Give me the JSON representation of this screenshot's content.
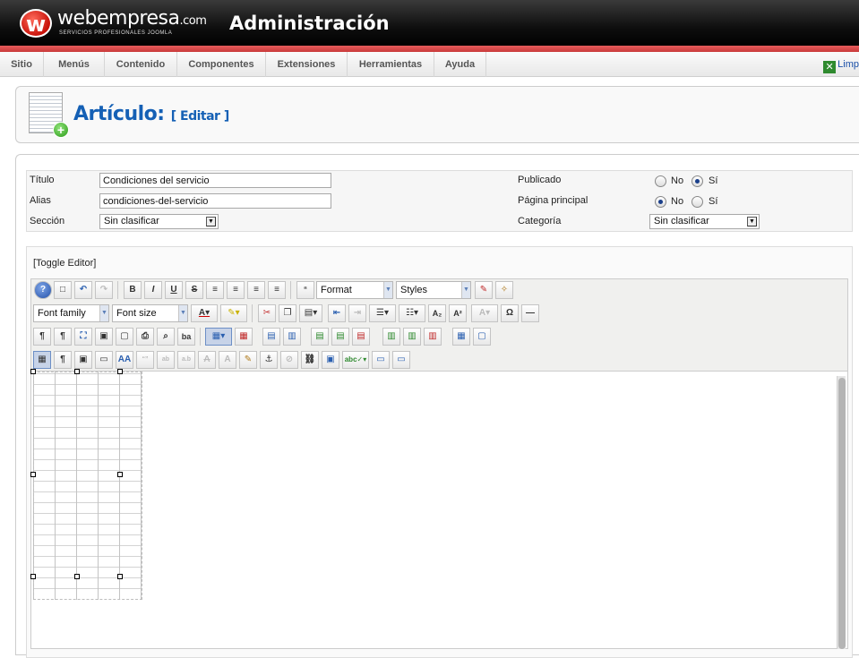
{
  "brand": {
    "name": "webempresa",
    "tld": ".com",
    "tagline": "SERVICIOS PROFESIONALES JOOMLA",
    "app_title": "Administración"
  },
  "menu": {
    "items": [
      "Sitio",
      "Menús",
      "Contenido",
      "Componentes",
      "Extensiones",
      "Herramientas",
      "Ayuda"
    ],
    "logout_label": "Limp"
  },
  "page": {
    "title": "Artículo:",
    "edit_label": "[ Editar ]"
  },
  "form": {
    "titulo_label": "Título",
    "titulo_value": "Condiciones del servicio",
    "alias_label": "Alias",
    "alias_value": "condiciones-del-servicio",
    "seccion_label": "Sección",
    "seccion_value": "Sin clasificar",
    "publicado_label": "Publicado",
    "pagina_label": "Página principal",
    "categoria_label": "Categoría",
    "categoria_value": "Sin clasificar",
    "no_label": "No",
    "si_label": "Sí",
    "publicado_selected": "Sí",
    "pagina_selected": "No"
  },
  "editor": {
    "toggle_label": "[Toggle Editor]",
    "format_label": "Format",
    "styles_label": "Styles",
    "font_family_label": "Font family",
    "font_size_label": "Font size"
  }
}
